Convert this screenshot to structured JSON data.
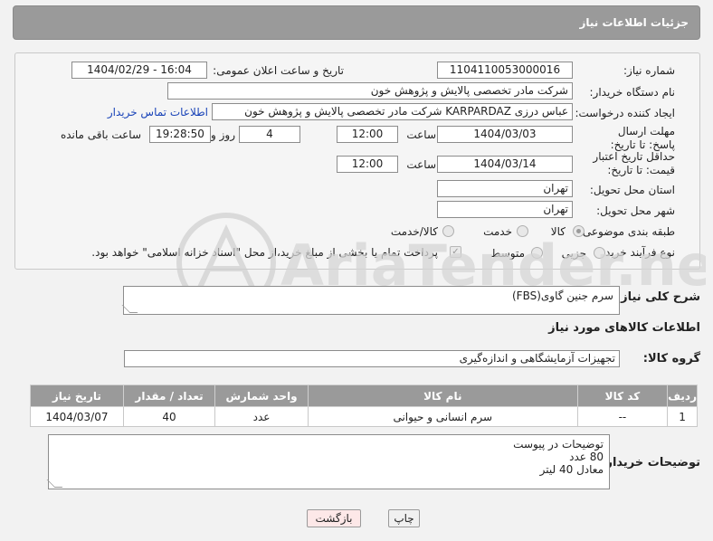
{
  "header": {
    "title": "جزئیات اطلاعات نیاز"
  },
  "labels": {
    "need_number": "شماره نیاز:",
    "announce_datetime": "تاریخ و ساعت اعلان عمومی:",
    "buyer_org": "نام دستگاه خریدار:",
    "creator": "ایجاد کننده درخواست:",
    "buyer_contact": "اطلاعات تماس خریدار",
    "reply_deadline": "مهلت ارسال پاسخ: تا تاریخ:",
    "time": "ساعت",
    "day_and": "روز و",
    "remaining": "ساعت باقی مانده",
    "price_validity": "حداقل تاریخ اعتبار قیمت: تا تاریخ:",
    "province": "استان محل تحویل:",
    "city": "شهر محل تحویل:",
    "category": "طبقه بندی موضوعی:",
    "purchase_type": "نوع فرآیند خرید :",
    "payment_note": "پرداخت تمام یا بخشی از مبلغ خرید،از محل \"اسناد خزانه اسلامی\" خواهد بود.",
    "general_desc": "شرح کلی نیاز:",
    "goods_info": "اطلاعات کالاهای مورد نیاز",
    "goods_group": "گروه کالا:",
    "buyer_notes": "توضیحات خریدار:"
  },
  "fields": {
    "need_number": "1104110053000016",
    "announce_datetime": "1404/02/29 - 16:04",
    "buyer_org": "شرکت مادر تخصصی پالایش و پژوهش خون",
    "creator": "عباس درزی KARPARDAZ شرکت مادر تخصصی پالایش و پژوهش خون",
    "reply_date": "1404/03/03",
    "reply_time": "12:00",
    "reply_days": "4",
    "reply_remaining": "19:28:50",
    "validity_date": "1404/03/14",
    "validity_time": "12:00",
    "province": "تهران",
    "city": "تهران",
    "general_desc": "سرم جنین گاوی(FBS)",
    "goods_group": "تجهیزات آزمایشگاهی و اندازه‌گیری",
    "buyer_notes": [
      "توضیحات در پیوست",
      "80 عدد",
      "معادل 40 لیتر"
    ]
  },
  "category_options": {
    "goods": "کالا",
    "service": "خدمت",
    "goods_service": "کالا/خدمت",
    "selected": "کالا"
  },
  "purchase_options": {
    "partial": "جزیی",
    "medium": "متوسط",
    "selected": "جزیی"
  },
  "table": {
    "headers": [
      "ردیف",
      "کد کالا",
      "نام کالا",
      "واحد شمارش",
      "تعداد / مقدار",
      "تاریخ نیاز"
    ],
    "rows": [
      [
        "1",
        "--",
        "سرم انسانی و حیوانی",
        "عدد",
        "40",
        "1404/03/07"
      ]
    ]
  },
  "buttons": {
    "print": "چاپ",
    "back": "بازگشت"
  },
  "watermark": {
    "text": "AriaTender.neT"
  },
  "colors": {
    "header_bg": "#9a9a9a",
    "link": "#1a44b8",
    "back_button_bg": "#fde8e8"
  }
}
